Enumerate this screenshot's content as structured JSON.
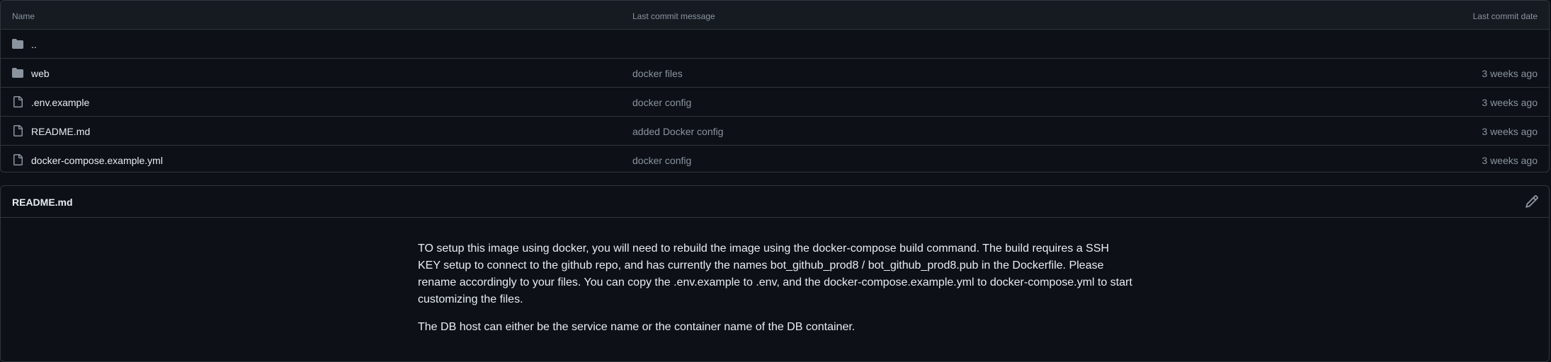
{
  "table": {
    "headers": {
      "name": "Name",
      "message": "Last commit message",
      "date": "Last commit date"
    },
    "rows": [
      {
        "type": "folder",
        "icon": "folder-icon",
        "name": "..",
        "message": "",
        "date": ""
      },
      {
        "type": "folder",
        "icon": "folder-icon",
        "name": "web",
        "message": "docker files",
        "date": "3 weeks ago"
      },
      {
        "type": "file",
        "icon": "file-icon",
        "name": ".env.example",
        "message": "docker config",
        "date": "3 weeks ago"
      },
      {
        "type": "file",
        "icon": "file-icon",
        "name": "README.md",
        "message": "added Docker config",
        "date": "3 weeks ago"
      },
      {
        "type": "file",
        "icon": "file-icon",
        "name": "docker-compose.example.yml",
        "message": "docker config",
        "date": "3 weeks ago"
      }
    ]
  },
  "readme": {
    "title": "README.md",
    "edit_icon": "pencil-icon",
    "paragraphs": [
      "TO setup this image using docker, you will need to rebuild the image using the docker-compose build command. The build requires a SSH KEY setup to connect to the github repo, and has currently the names bot_github_prod8 / bot_github_prod8.pub in the Dockerfile. Please rename accordingly to your files. You can copy the .env.example to .env, and the docker-compose.example.yml to docker-compose.yml to start customizing the files.",
      "The DB host can either be the service name or the container name of the DB container."
    ]
  },
  "colors": {
    "background": "#0d1117",
    "header_bg": "#161b22",
    "border": "#30363d",
    "text": "#e6edf3",
    "muted": "#8b949e",
    "icon": "#8b949e"
  }
}
